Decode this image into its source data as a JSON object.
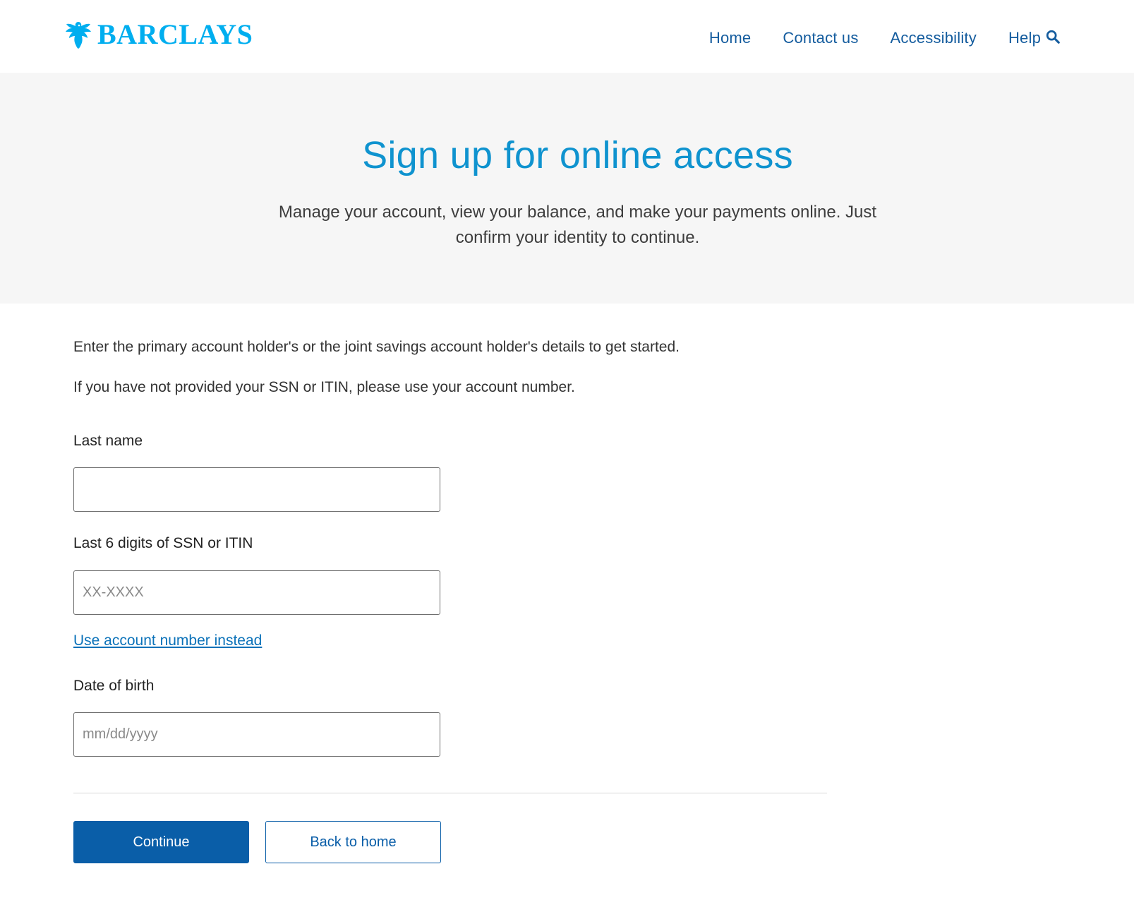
{
  "header": {
    "logo_text": "BARCLAYS",
    "nav": {
      "home": "Home",
      "contact": "Contact us",
      "accessibility": "Accessibility",
      "help": "Help"
    },
    "icons": {
      "logo": "eagle-icon",
      "search": "search-icon"
    }
  },
  "hero": {
    "title": "Sign up for online access",
    "description": "Manage your account, view your balance, and make your payments online. Just confirm your identity to continue."
  },
  "form": {
    "intro_1": "Enter the primary account holder's or the joint savings account holder's details to get started.",
    "intro_2": "If you have not provided your SSN or ITIN, please use your account number.",
    "last_name": {
      "label": "Last name",
      "value": "",
      "placeholder": ""
    },
    "ssn": {
      "label": "Last 6 digits of SSN or ITIN",
      "value": "",
      "placeholder": "XX-XXXX"
    },
    "use_account_link": "Use account number instead",
    "dob": {
      "label": "Date of birth",
      "value": "",
      "placeholder": "mm/dd/yyyy"
    },
    "continue_label": "Continue",
    "back_label": "Back to home"
  },
  "colors": {
    "brand": "#00aeef",
    "nav_link": "#145c9e",
    "title": "#0f93cf",
    "primary_button": "#0a5ea8",
    "link": "#0b72b9",
    "hero_background": "#f6f6f6"
  }
}
